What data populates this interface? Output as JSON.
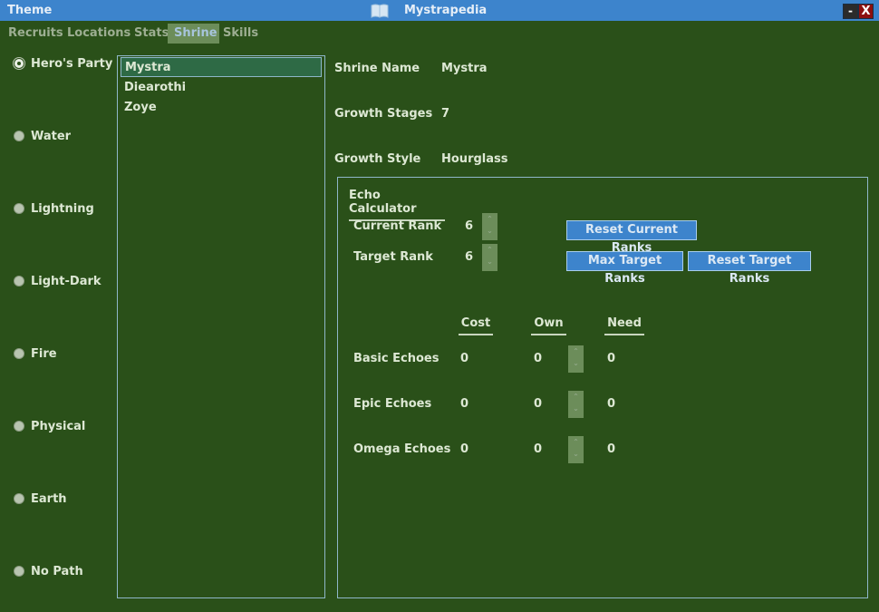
{
  "titlebar": {
    "menu": "Theme",
    "title": "Mystrapedia",
    "minimize": "-",
    "close": "X"
  },
  "tabs": [
    {
      "label": "Recruits"
    },
    {
      "label": "Locations"
    },
    {
      "label": "Stats"
    },
    {
      "label": "Shrine",
      "active": true
    },
    {
      "label": "Skills"
    }
  ],
  "paths": [
    {
      "label": "Hero's Party",
      "checked": true
    },
    {
      "label": "Water"
    },
    {
      "label": "Lightning"
    },
    {
      "label": "Light-Dark"
    },
    {
      "label": "Fire"
    },
    {
      "label": "Physical"
    },
    {
      "label": "Earth"
    },
    {
      "label": "No Path"
    }
  ],
  "shrines": [
    {
      "label": "Mystra",
      "selected": true
    },
    {
      "label": "Diearothi"
    },
    {
      "label": "Zoye"
    }
  ],
  "info": {
    "shrine_name_label": "Shrine Name",
    "shrine_name_value": "Mystra",
    "growth_stages_label": "Growth Stages",
    "growth_stages_value": "7",
    "growth_style_label": "Growth Style",
    "growth_style_value": "Hourglass"
  },
  "calculator": {
    "title": "Echo Calculator",
    "current_rank_label": "Current Rank",
    "current_rank_value": "6",
    "target_rank_label": "Target Rank",
    "target_rank_value": "6",
    "reset_current_label": "Reset Current Ranks",
    "max_target_label": "Max Target Ranks",
    "reset_target_label": "Reset Target Ranks",
    "columns": [
      "Cost",
      "Own",
      "Need"
    ],
    "rows": [
      {
        "label": "Basic Echoes",
        "cost": "0",
        "own": "0",
        "need": "0"
      },
      {
        "label": "Epic Echoes",
        "cost": "0",
        "own": "0",
        "need": "0"
      },
      {
        "label": "Omega Echoes",
        "cost": "0",
        "own": "0",
        "need": "0"
      }
    ]
  },
  "colors": {
    "background": "#2a5019",
    "titlebar": "#3d84cc",
    "accent_button": "#3d84cc",
    "selected_item": "#2e6a45",
    "active_tab": "#6c8d5a"
  }
}
